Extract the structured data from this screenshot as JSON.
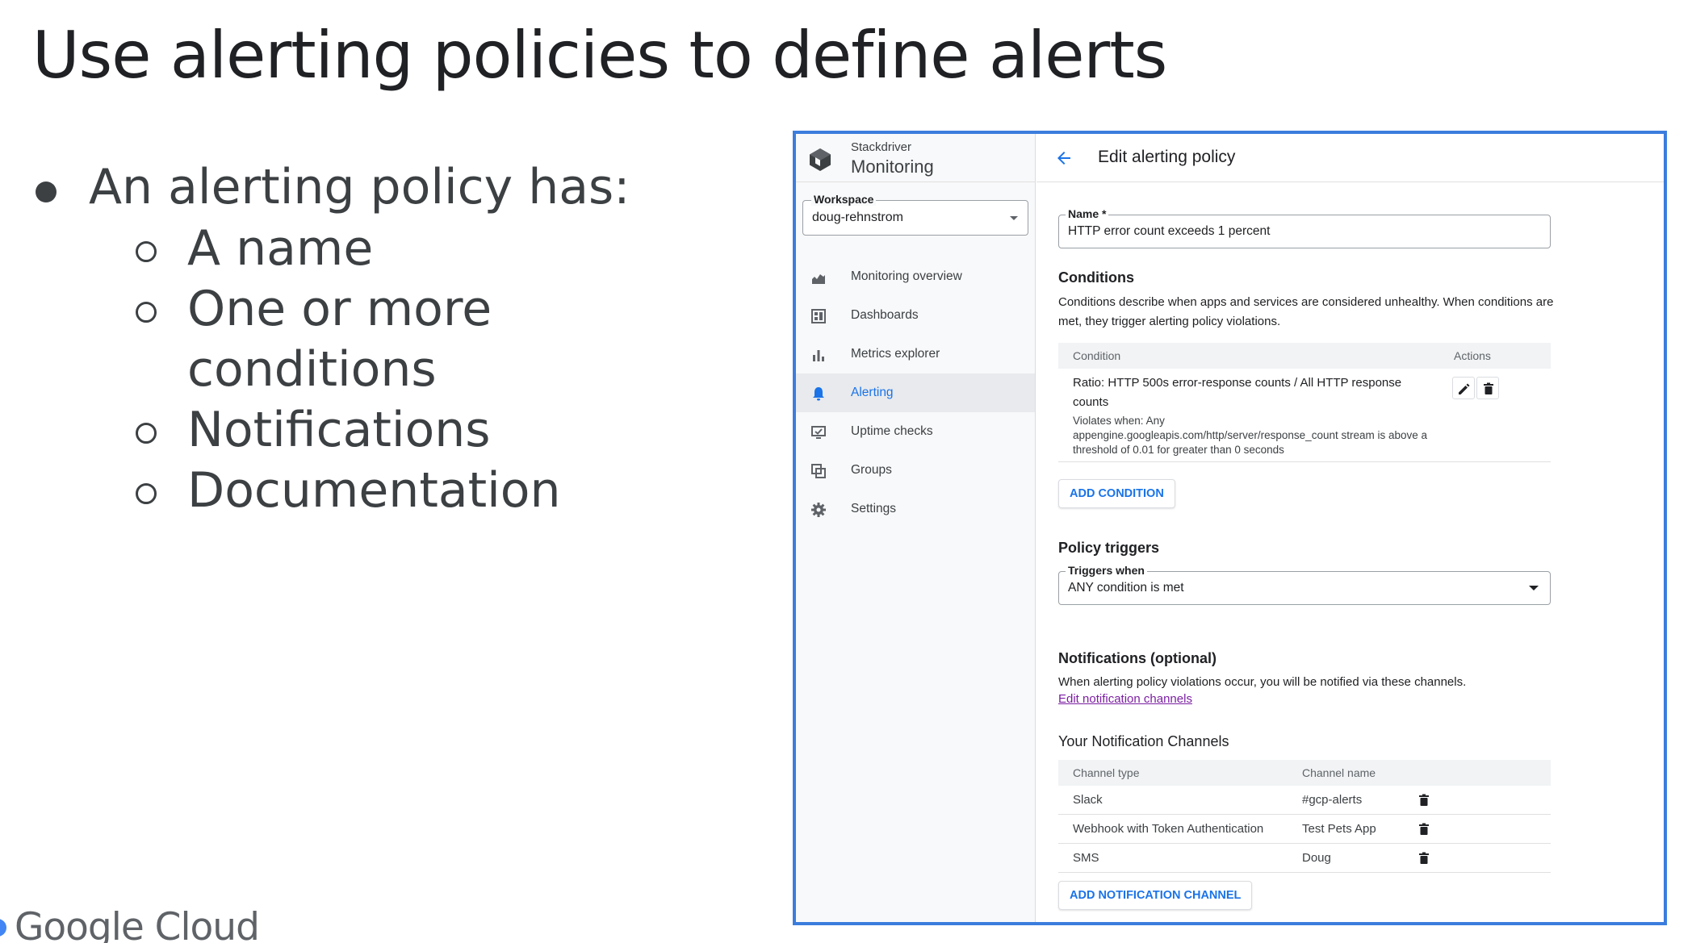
{
  "slide": {
    "title": "Use alerting policies to define alerts",
    "bullet_main": "An alerting policy has:",
    "sub_items": [
      "A name",
      "One or more",
      "conditions",
      "Notifications",
      "Documentation"
    ],
    "footer_logo": "Google Cloud"
  },
  "app": {
    "brand_small": "Stackdriver",
    "brand_name": "Monitoring",
    "workspace_label": "Workspace",
    "workspace_value": "doug-rehnstrom",
    "nav": [
      {
        "label": "Monitoring overview",
        "icon": "monitoring-overview-icon"
      },
      {
        "label": "Dashboards",
        "icon": "dashboards-icon"
      },
      {
        "label": "Metrics explorer",
        "icon": "metrics-explorer-icon"
      },
      {
        "label": "Alerting",
        "icon": "bell-icon",
        "active": true
      },
      {
        "label": "Uptime checks",
        "icon": "uptime-checks-icon"
      },
      {
        "label": "Groups",
        "icon": "groups-icon"
      },
      {
        "label": "Settings",
        "icon": "gear-icon"
      }
    ],
    "page_title": "Edit alerting policy",
    "name_label": "Name *",
    "name_value": "HTTP error count exceeds 1 percent",
    "conditions": {
      "heading": "Conditions",
      "description": "Conditions describe when apps and services are considered unhealthy. When conditions are met, they trigger alerting policy violations.",
      "col_condition": "Condition",
      "col_actions": "Actions",
      "row_title": "Ratio: HTTP 500s error-response counts / All HTTP response counts",
      "row_detail": "Violates when: Any appengine.googleapis.com/http/server/response_count stream is above a threshold of 0.01 for greater than 0 seconds",
      "add_button": "ADD CONDITION"
    },
    "triggers": {
      "heading": "Policy triggers",
      "label": "Triggers when",
      "value": "ANY condition is met"
    },
    "notifications": {
      "heading": "Notifications (optional)",
      "description": "When alerting policy violations occur, you will be notified via these channels.",
      "edit_link": "Edit notification channels",
      "channels_heading": "Your Notification Channels",
      "col_type": "Channel type",
      "col_name": "Channel name",
      "rows": [
        {
          "type": "Slack",
          "name": "#gcp-alerts"
        },
        {
          "type": "Webhook with Token Authentication",
          "name": "Test Pets App"
        },
        {
          "type": "SMS",
          "name": "Doug"
        }
      ],
      "add_button": "ADD NOTIFICATION CHANNEL"
    },
    "colors": {
      "accent": "#1a73e8",
      "frame_border": "#3b7ddd",
      "link": "#7b1fa2"
    }
  }
}
